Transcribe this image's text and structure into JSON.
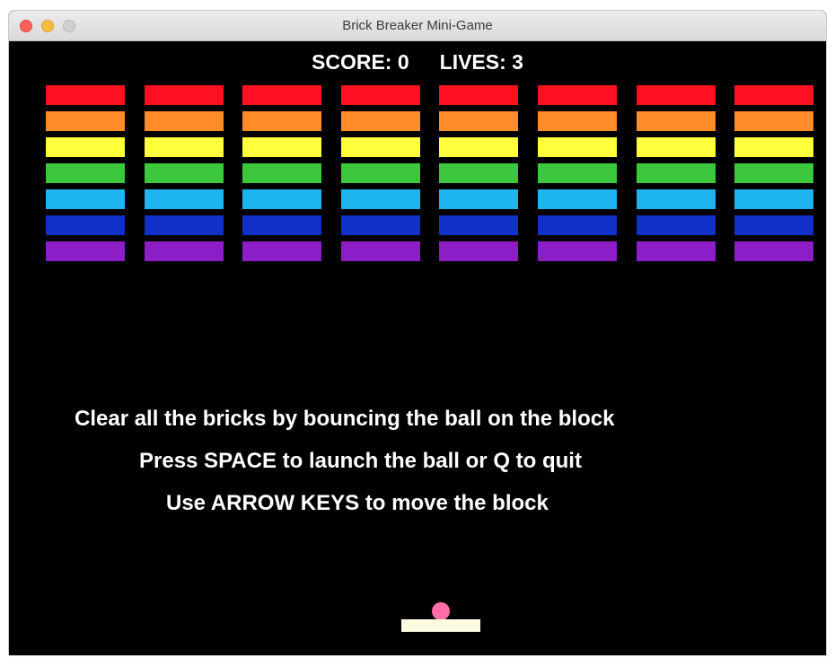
{
  "window": {
    "title": "Brick Breaker Mini-Game"
  },
  "hud": {
    "score_label": "SCORE: 0",
    "lives_label": "LIVES: 3",
    "score": 0,
    "lives": 3
  },
  "bricks": {
    "rows": 7,
    "columns": 8,
    "row_colors": [
      "#ff1020",
      "#ff8c28",
      "#ffff3c",
      "#3cc83c",
      "#1eb4f0",
      "#1030c8",
      "#8c1ec8"
    ]
  },
  "instructions": {
    "line1": "Clear all the bricks by bouncing the ball on the block",
    "line2": "Press SPACE to launch the ball or Q to quit",
    "line3": "Use ARROW KEYS to move the block"
  },
  "colors": {
    "background": "#000000",
    "paddle": "#fffbe0",
    "ball": "#ff6ea8"
  }
}
